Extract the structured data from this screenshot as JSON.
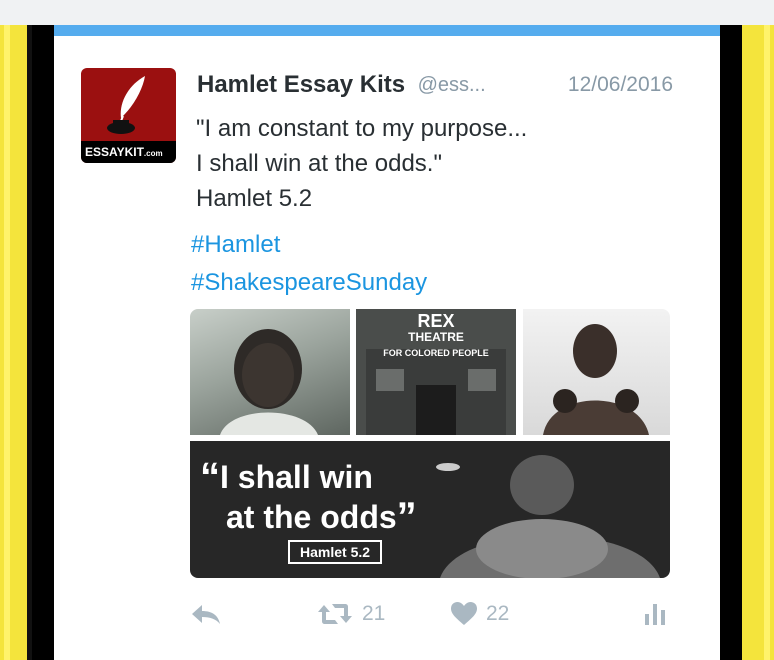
{
  "tweet": {
    "author_name": "Hamlet Essay Kits",
    "author_handle": "@ess...",
    "date": "12/06/2016",
    "avatar": {
      "logo_text": "ESSAYKIT",
      "logo_suffix": ".com",
      "icon": "quill-inkwell-icon",
      "color": "#9b1010"
    },
    "text_lines": [
      "\"I am constant to my purpose...",
      "I shall win at the odds.\"",
      "Hamlet 5.2"
    ],
    "hashtags": [
      "#Hamlet",
      "#ShakespeareSunday"
    ],
    "media": {
      "photos": [
        {
          "icon": "childhood-portrait-photo"
        },
        {
          "label_line1": "REX",
          "label_line2": "THEATRE",
          "label_line3": "FOR COLORED PEOPLE"
        },
        {
          "icon": "young-boxer-photo"
        }
      ],
      "quote_open": "“",
      "quote_line1": "I shall win",
      "quote_line2": "at the odds",
      "quote_close": "”",
      "quote_ref": "Hamlet 5.2"
    },
    "actions": {
      "reply_icon": "reply-icon",
      "retweet_icon": "retweet-icon",
      "retweet_count": "21",
      "like_icon": "heart-icon",
      "like_count": "22",
      "analytics_icon": "analytics-icon"
    }
  },
  "colors": {
    "accent_bar": "#55acee",
    "hashtag": "#1b95e0",
    "muted": "#8899a6",
    "action": "#aab8c2"
  }
}
